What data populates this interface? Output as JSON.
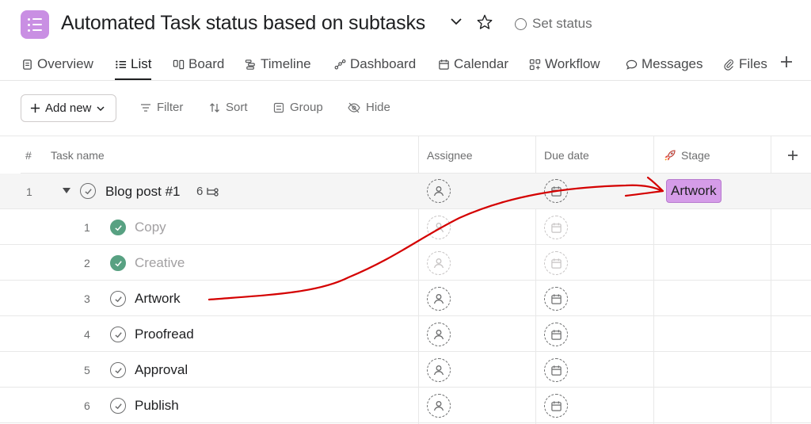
{
  "header": {
    "title": "Automated Task status based on subtasks",
    "set_status": "Set status"
  },
  "tabs": [
    {
      "label": "Overview",
      "icon": "overview-icon"
    },
    {
      "label": "List",
      "icon": "list-icon",
      "active": true
    },
    {
      "label": "Board",
      "icon": "board-icon"
    },
    {
      "label": "Timeline",
      "icon": "timeline-icon"
    },
    {
      "label": "Dashboard",
      "icon": "dashboard-icon"
    },
    {
      "label": "Calendar",
      "icon": "calendar-icon"
    },
    {
      "label": "Workflow",
      "icon": "workflow-icon"
    },
    {
      "label": "Messages",
      "icon": "messages-icon"
    },
    {
      "label": "Files",
      "icon": "files-icon"
    }
  ],
  "toolbar": {
    "add_new": "Add new",
    "filter": "Filter",
    "sort": "Sort",
    "group": "Group",
    "hide": "Hide"
  },
  "columns": {
    "num": "#",
    "task_name": "Task name",
    "assignee": "Assignee",
    "due_date": "Due date",
    "stage": "Stage"
  },
  "parent_task": {
    "num": "1",
    "name": "Blog post #1",
    "subtask_count": "6",
    "stage": "Artwork"
  },
  "subtasks": [
    {
      "num": "1",
      "name": "Copy",
      "done": true
    },
    {
      "num": "2",
      "name": "Creative",
      "done": true
    },
    {
      "num": "3",
      "name": "Artwork",
      "done": false
    },
    {
      "num": "4",
      "name": "Proofread",
      "done": false
    },
    {
      "num": "5",
      "name": "Approval",
      "done": false
    },
    {
      "num": "6",
      "name": "Publish",
      "done": false
    }
  ],
  "colors": {
    "stage_tag": "#d59ce8",
    "done_check": "#58a182",
    "annotation": "#d40000",
    "project_icon": "#c98fe3"
  }
}
